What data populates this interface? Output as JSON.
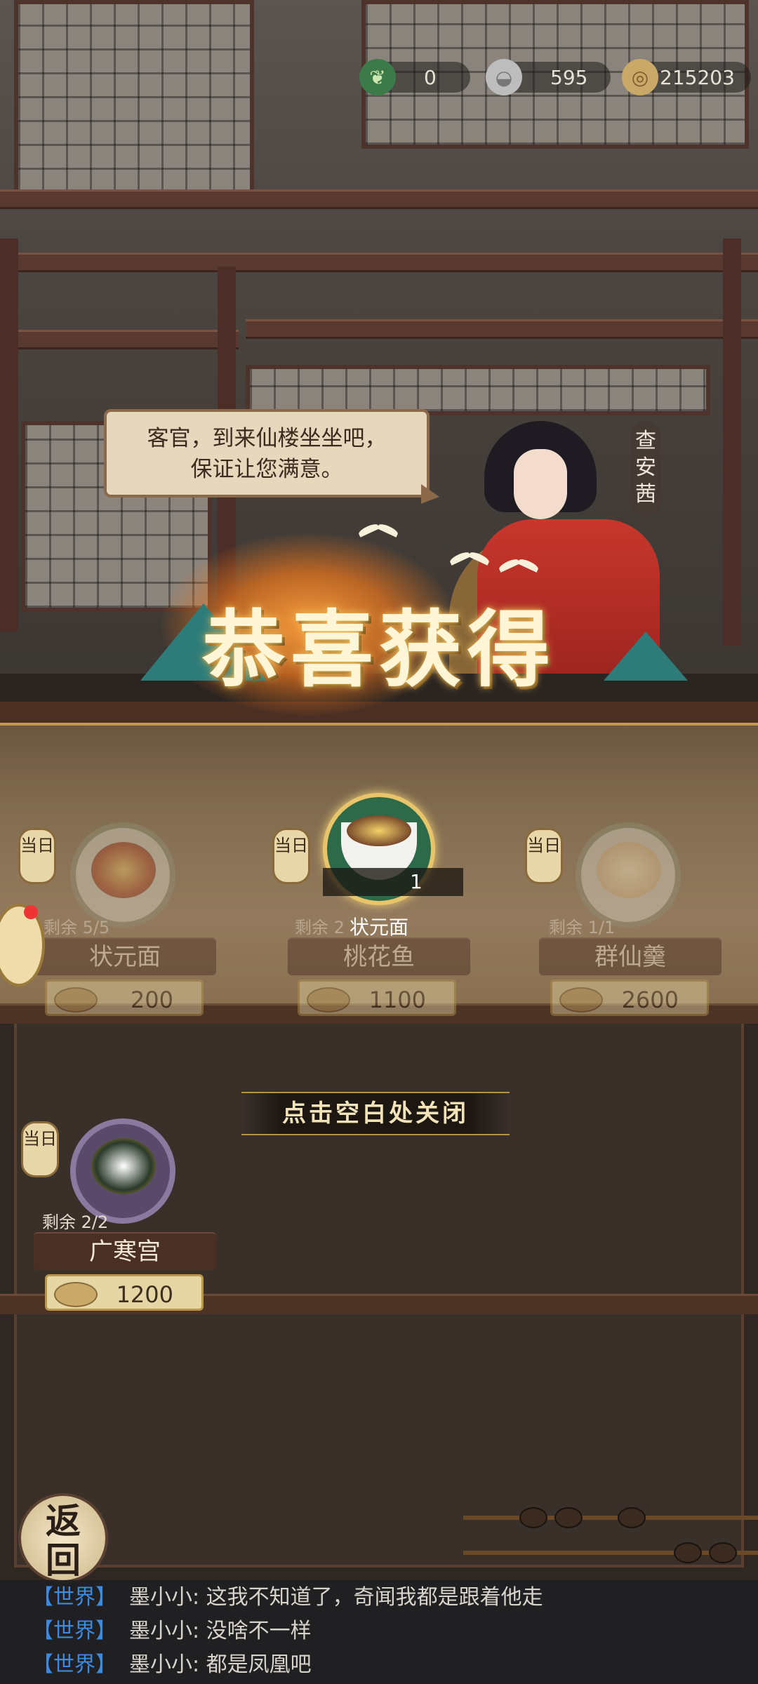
{
  "currencies": [
    {
      "icon": "jade-leaf-icon",
      "value": "0"
    },
    {
      "icon": "silver-ingot-icon",
      "value": "595"
    },
    {
      "icon": "copper-coin-icon",
      "value": "215203"
    }
  ],
  "npc": {
    "speech_line1": "客官，到来仙楼坐坐吧，",
    "speech_line2": "保证让您满意。",
    "name": "查安茜"
  },
  "popup": {
    "title": "恭喜获得",
    "reward_name": "状元面",
    "reward_count": "1",
    "close_hint": "点击空白处关闭"
  },
  "lantern_label": "当日",
  "dishes": [
    {
      "name": "状元面",
      "remaining": "剩余 5/5",
      "price": "200"
    },
    {
      "name": "桃花鱼",
      "remaining": "剩余 2",
      "price": "1100"
    },
    {
      "name": "群仙羹",
      "remaining": "剩余 1/1",
      "price": "2600"
    },
    {
      "name": "广寒宫",
      "remaining": "剩余 2/2",
      "price": "1200"
    }
  ],
  "back_button": {
    "line1": "返",
    "line2": "回"
  },
  "chat": [
    {
      "channel": "【世界】",
      "message": "墨小小: 这我不知道了，奇闻我都是跟着他走"
    },
    {
      "channel": "【世界】",
      "message": "墨小小: 没啥不一样"
    },
    {
      "channel": "【世界】",
      "message": "墨小小: 都是凤凰吧"
    }
  ],
  "colors": {
    "accent_gold": "#e8c46a",
    "chat_channel": "#3d8be0",
    "dress_red": "#c8372c"
  }
}
